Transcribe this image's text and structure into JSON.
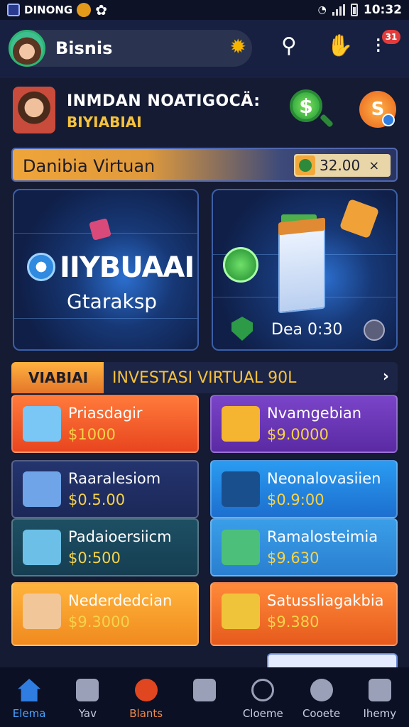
{
  "status_bar": {
    "app_label": "DINONG",
    "time": "10:32"
  },
  "header": {
    "title": "Bisnis",
    "notification_count": "31"
  },
  "notice": {
    "title": "INMDAN NOATIGOCÄ:",
    "subtitle": "BIYIABIAI"
  },
  "banner": {
    "title": "Danibia Virtuan",
    "amount": "32.00",
    "close": "×"
  },
  "features": {
    "left": {
      "big": "IIYBUAAI",
      "sub": "Gtaraksp"
    },
    "right": {
      "date": "Dea 0:30"
    }
  },
  "investasi": {
    "tab": "VIABIAI",
    "title": "INVESTASI VIRTUAL 90L",
    "chevron": "›"
  },
  "investments": [
    {
      "label": "Priasdagir",
      "value": "$1000",
      "color_top": "#ff7a3a",
      "color_bottom": "#e8451f",
      "icon": "server-icon"
    },
    {
      "label": "Nvamgebian",
      "value": "$9.0000",
      "color_top": "#7a44c8",
      "color_bottom": "#5a2aa3",
      "icon": "gear-coin-icon"
    },
    {
      "label": "Raaralesiom",
      "value": "$0.5.00",
      "color_top": "#24346e",
      "color_bottom": "#1b2858",
      "icon": "monitor-icon"
    },
    {
      "label": "Neonalovasiien",
      "value": "$0.9:00",
      "color_top": "#2a9bf0",
      "color_bottom": "#1d6fcf",
      "icon": "globe-monitor-icon"
    },
    {
      "label": "Padaioersiicm",
      "value": "$0:500",
      "color_top": "#1d4f63",
      "color_bottom": "#163e52",
      "icon": "computer-icon"
    },
    {
      "label": "Ramalosteimia",
      "value": "$9.630",
      "color_top": "#3a9ee8",
      "color_bottom": "#2a7fd0",
      "icon": "map-icon"
    },
    {
      "label": "Nederdedcian",
      "value": "$9.3000",
      "color_top": "#ffb43c",
      "color_bottom": "#f08a1f",
      "icon": "person-icon"
    },
    {
      "label": "Satussliagakbia",
      "value": "$9.380",
      "color_top": "#ff8a3a",
      "color_bottom": "#e65a1c",
      "icon": "shield-dollar-icon"
    }
  ],
  "bottom_nav": [
    {
      "label": "Elema",
      "name": "nav-home"
    },
    {
      "label": "Yav",
      "name": "nav-wallet"
    },
    {
      "label": "Blants",
      "name": "nav-plans"
    },
    {
      "label": "",
      "name": "nav-games"
    },
    {
      "label": "Cloeme",
      "name": "nav-chart"
    },
    {
      "label": "Cooete",
      "name": "nav-profile"
    },
    {
      "label": "Ihemy",
      "name": "nav-history"
    }
  ]
}
